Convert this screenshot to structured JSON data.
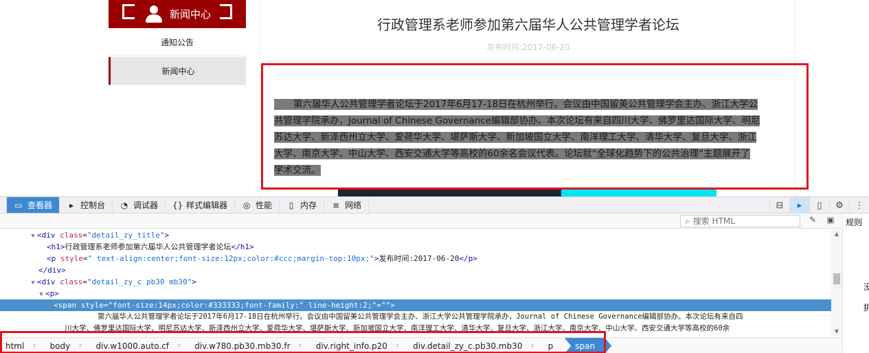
{
  "site": {
    "nav_header": "新闻中心",
    "sidebar": [
      {
        "label": "通知公告"
      },
      {
        "label": "新闻中心"
      }
    ],
    "accent_color": "#9b0000"
  },
  "article": {
    "title": "行政管理系老师参加第六届华人公共管理学者论坛",
    "date": "发布时间:2017-06-20",
    "lines": [
      "第六届华人公共管理学者论坛于2017年6月17-18日在杭州举行。会议由中国留美公共管理学会主办、浙江大学公",
      "共管理学院承办，Journal of Chinese Governance编辑部协办。本次论坛有来自四川大学、佛罗里达国际大学、明尼",
      "苏达大学、新泽西州立大学、爱荷华大学、堪萨斯大学、新加坡国立大学、南洋理工大学、清华大学、复旦大学、浙江",
      "大学、南京大学、中山大学、西安交通大学等高校的60余名会议代表。论坛就“全球化趋势下的公共治理”主题展开了",
      "学术交流。"
    ]
  },
  "devtools": {
    "tabs": [
      {
        "icon": "▭",
        "label": "查看器",
        "active": true
      },
      {
        "icon": "▸",
        "label": "控制台"
      },
      {
        "icon": "◔",
        "label": "调试器"
      },
      {
        "icon": "{}",
        "label": "样式编辑器"
      },
      {
        "icon": "◎",
        "label": "性能"
      },
      {
        "icon": "▯",
        "label": "内存"
      },
      {
        "icon": "≡",
        "label": "网络"
      }
    ],
    "search_placeholder": "搜索 HTML",
    "side_panel": {
      "tab": "规则",
      "text1": "没",
      "text2": "挑"
    },
    "markup": {
      "l0": {
        "tag_open": "<div ",
        "attr": "class",
        "eq": "=",
        "val": "\"detail_zy_title\"",
        "close": ">"
      },
      "l1": {
        "tag": "<h1>",
        "text": "行政管理系老师参加第六届华人公共管理学者论坛",
        "endtag": "</h1>"
      },
      "l2": {
        "tag_open": "<p ",
        "attr": "style",
        "eq": "=",
        "val": "\" text-align:center;font-size:12px;color:#ccc;margin-top:10px;\"",
        "close": ">",
        "text": "发布时间:2017-06-20",
        "endtag": "</p>"
      },
      "l3": {
        "tag": "</div>"
      },
      "l4": {
        "tag_open": "<div ",
        "attr": "class",
        "eq": "=",
        "val": "\"detail_zy_c pb30 mb30\"",
        "close": ">"
      },
      "l5": {
        "tag": "<p>"
      },
      "l6": {
        "tag_open": "<span ",
        "attr": "style",
        "eq": "=",
        "val": "\"font-size:14px;color:#333333;font-family:\" line-height:2;\"=\"\"",
        "close": ">"
      },
      "l7": {
        "text": "第六届华人公共管理学者论坛于2017年6月17-18日在杭州举行。会议由中国留美公共管理学会主办、浙江大学公共管理学院承办，Journal of Chinese Governance编辑部协办。本次论坛有来自四"
      },
      "l8": {
        "text": "川大学、佛罗里达国际大学、明尼苏达大学、新泽西州立大学、爱荷华大学、堪萨斯大学、新加坡国立大学、南洋理工大学、清华大学、复旦大学、浙江大学、南京大学、中山大学、西安交通大学等高校的60余"
      }
    },
    "breadcrumbs": [
      "html",
      "body",
      "div.w1000.auto.cf",
      "div.w780.pb30.mb30.fr",
      "div.right_info.p20",
      "div.detail_zy_c.pb30.mb30",
      "p",
      "span"
    ]
  }
}
